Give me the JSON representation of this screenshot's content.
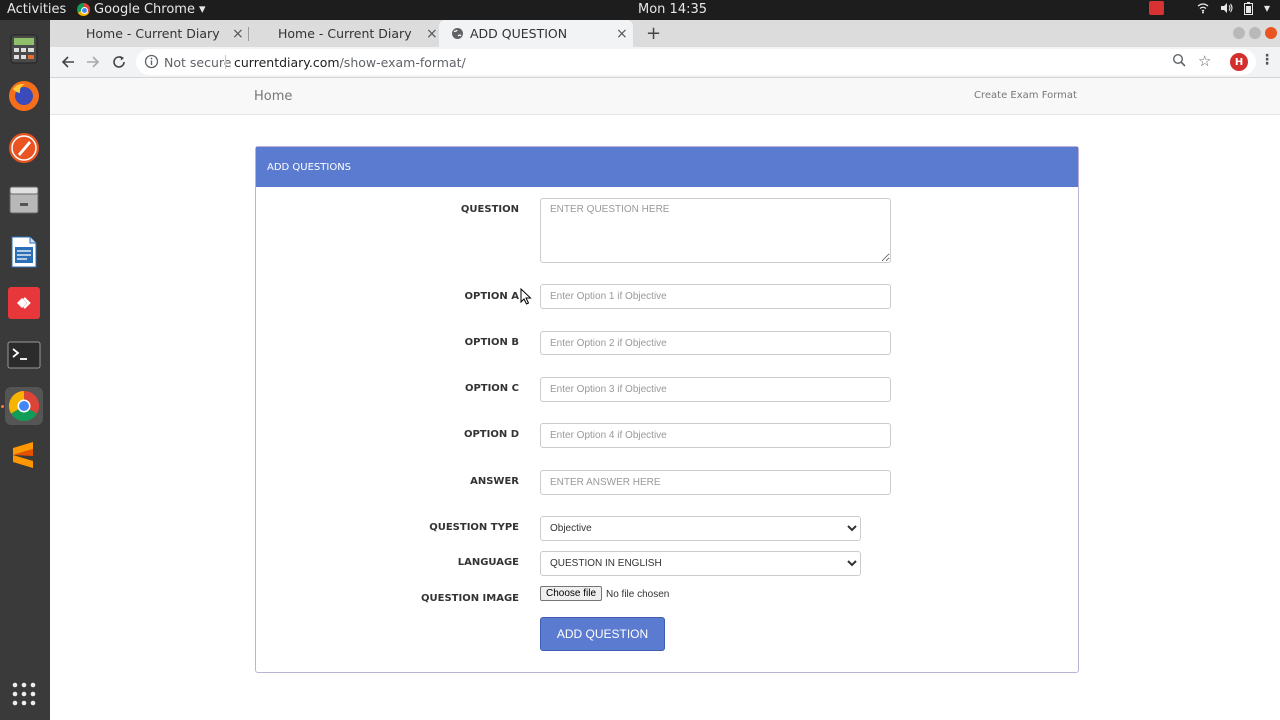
{
  "topbar": {
    "activities": "Activities",
    "app_name": "Google Chrome",
    "clock": "Mon 14:35"
  },
  "dock": {
    "items": [
      "calculator-icon",
      "firefox-icon",
      "rhythmbox-icon",
      "files-icon",
      "writer-icon",
      "anydesk-icon",
      "terminal-icon",
      "chrome-icon",
      "sublime-icon",
      "app-grid-icon"
    ]
  },
  "browser": {
    "tabs": [
      {
        "title": "Home - Current Diary"
      },
      {
        "title": "Home - Current Diary"
      },
      {
        "title": "ADD QUESTION"
      }
    ],
    "active_tab": 2,
    "security": "Not secure",
    "url_host": "currentdiary.com",
    "url_path": "/show-exam-format/",
    "profile_initial": "H"
  },
  "site": {
    "nav_home": "Home",
    "nav_right": "Create Exam Format"
  },
  "form": {
    "heading": "ADD QUESTIONS",
    "question_label": "QUESTION",
    "question_placeholder": "ENTER QUESTION HERE",
    "option_a_label": "OPTION A",
    "option_a_placeholder": "Enter Option 1 if Objective",
    "option_b_label": "OPTION B",
    "option_b_placeholder": "Enter Option 2 if Objective",
    "option_c_label": "OPTION C",
    "option_c_placeholder": "Enter Option 3 if Objective",
    "option_d_label": "OPTION D",
    "option_d_placeholder": "Enter Option 4 if Objective",
    "answer_label": "ANSWER",
    "answer_placeholder": "ENTER ANSWER HERE",
    "question_type_label": "QUESTION TYPE",
    "question_type_value": "Objective",
    "language_label": "LANGUAGE",
    "language_value": "QUESTION IN ENGLISH",
    "image_label": "QUESTION IMAGE",
    "file_button": "Choose file",
    "file_status": "No file chosen",
    "submit_label": "ADD QUESTION"
  },
  "colors": {
    "accent": "#5b7bd0",
    "tab_strip": "#dcdcdc",
    "dock": "#3a3a3a"
  }
}
